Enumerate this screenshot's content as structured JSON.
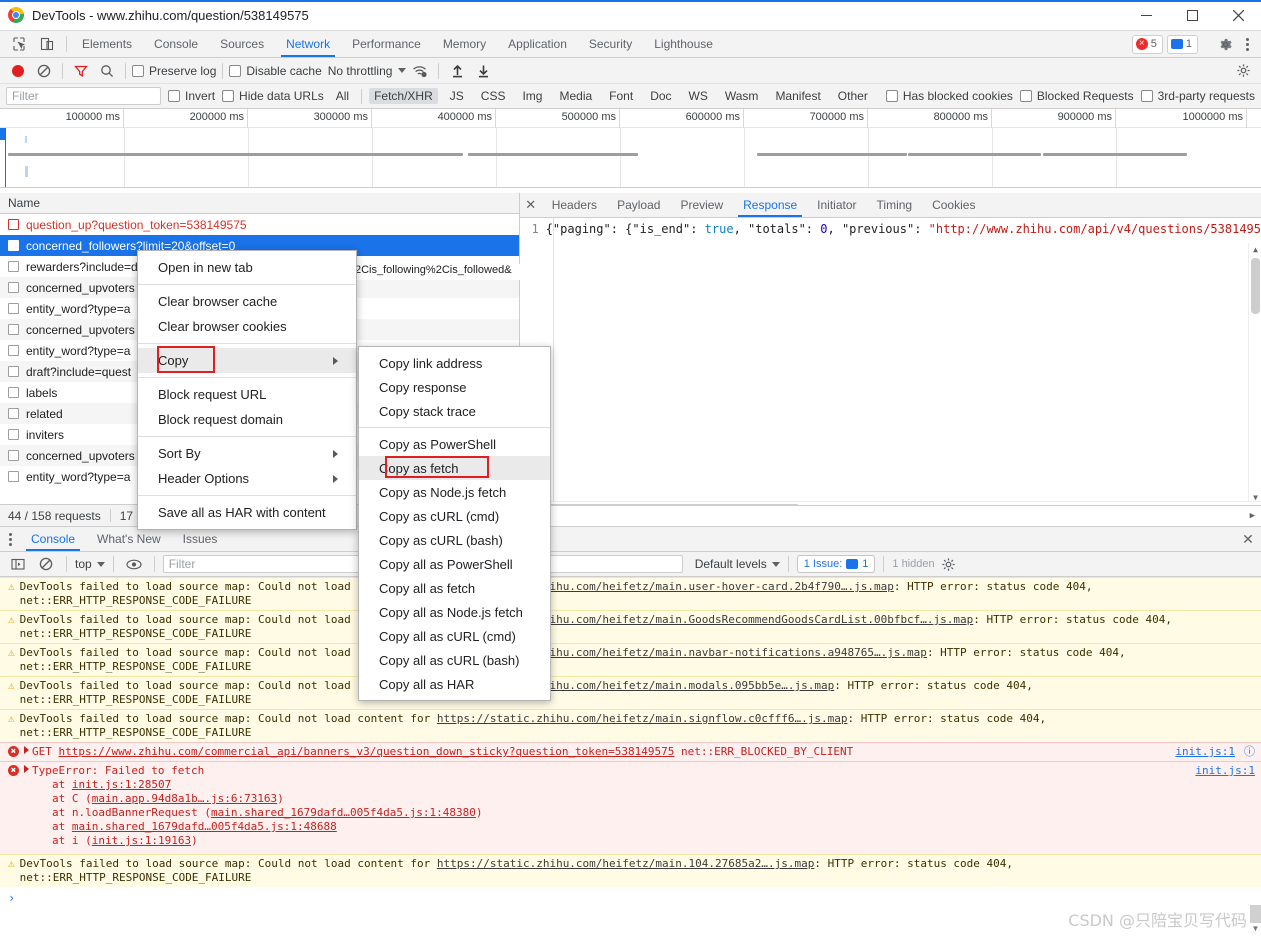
{
  "window": {
    "title": "DevTools - www.zhihu.com/question/538149575",
    "logo_icon": "chrome-logo",
    "minimize": "–",
    "maximize": "□",
    "close": "✕"
  },
  "main_tabs": {
    "inspect_icon": "inspect-cursor-icon",
    "device_icon": "device-toggle-icon",
    "items": [
      {
        "label": "Elements",
        "active": false
      },
      {
        "label": "Console",
        "active": false
      },
      {
        "label": "Sources",
        "active": false
      },
      {
        "label": "Network",
        "active": true
      },
      {
        "label": "Performance",
        "active": false
      },
      {
        "label": "Memory",
        "active": false
      },
      {
        "label": "Application",
        "active": false
      },
      {
        "label": "Security",
        "active": false
      },
      {
        "label": "Lighthouse",
        "active": false
      }
    ],
    "error_badge": "5",
    "message_badge": "1",
    "settings_icon": "gear-icon",
    "more_icon": "kebab-menu-icon"
  },
  "network_toolbar": {
    "record_icon": "record-button",
    "clear_icon": "clear-circle-icon",
    "filter_icon": "funnel-icon",
    "search_icon": "search-icon",
    "preserve_log": "Preserve log",
    "disable_cache": "Disable cache",
    "throttling": "No throttling",
    "wifi_icon": "network-conditions-icon",
    "import_icon": "import-har-icon",
    "export_icon": "export-har-icon",
    "settings_icon": "network-settings-gear-icon"
  },
  "filter_bar": {
    "placeholder": "Filter",
    "invert": "Invert",
    "hide_data_urls": "Hide data URLs",
    "types": [
      {
        "label": "All",
        "active": false
      },
      {
        "label": "Fetch/XHR",
        "active": true
      },
      {
        "label": "JS",
        "active": false
      },
      {
        "label": "CSS",
        "active": false
      },
      {
        "label": "Img",
        "active": false
      },
      {
        "label": "Media",
        "active": false
      },
      {
        "label": "Font",
        "active": false
      },
      {
        "label": "Doc",
        "active": false
      },
      {
        "label": "WS",
        "active": false
      },
      {
        "label": "Wasm",
        "active": false
      },
      {
        "label": "Manifest",
        "active": false
      },
      {
        "label": "Other",
        "active": false
      }
    ],
    "has_blocked_cookies": "Has blocked cookies",
    "blocked_requests": "Blocked Requests",
    "third_party": "3rd-party requests"
  },
  "overview": {
    "ticks": [
      "100000 ms",
      "200000 ms",
      "300000 ms",
      "400000 ms",
      "500000 ms",
      "600000 ms",
      "700000 ms",
      "800000 ms",
      "900000 ms",
      "1000000 ms"
    ]
  },
  "requests": {
    "column_name": "Name",
    "rows": [
      {
        "name": "question_up?question_token=538149575",
        "state": "error"
      },
      {
        "name": "concerned_followers?limit=20&offset=0",
        "state": "selected"
      },
      {
        "name": "rewarders?include=d",
        "state": "normal"
      },
      {
        "name": "concerned_upvoters",
        "state": "normal"
      },
      {
        "name": "entity_word?type=a",
        "state": "normal"
      },
      {
        "name": "concerned_upvoters",
        "state": "normal"
      },
      {
        "name": "entity_word?type=a",
        "state": "normal"
      },
      {
        "name": "draft?include=quest",
        "state": "normal"
      },
      {
        "name": "labels",
        "state": "normal"
      },
      {
        "name": "related",
        "state": "normal"
      },
      {
        "name": "inviters",
        "state": "normal"
      },
      {
        "name": "concerned_upvoters",
        "state": "normal"
      },
      {
        "name": "entity_word?type=a",
        "state": "normal"
      }
    ],
    "status_requests": "44 / 158 requests",
    "status_transferred": "17"
  },
  "detail": {
    "close_icon": "close-icon",
    "tabs": [
      {
        "label": "Headers",
        "active": false
      },
      {
        "label": "Payload",
        "active": false
      },
      {
        "label": "Preview",
        "active": false
      },
      {
        "label": "Response",
        "active": true
      },
      {
        "label": "Initiator",
        "active": false
      },
      {
        "label": "Timing",
        "active": false
      },
      {
        "label": "Cookies",
        "active": false
      }
    ],
    "line_number": "1",
    "response_prefix": "{\"paging\": {\"is_end\": ",
    "response_true": "true",
    "response_mid": ", \"totals\": ",
    "response_zero": "0",
    "response_mid2": ", \"previous\": ",
    "response_url": "\"http://www.zhihu.com/api/v4/questions/5381495",
    "masked_text": "2Cis_following%2Cis_followed&",
    "bottom_brace": "{}"
  },
  "context_menu": {
    "items": [
      {
        "label": "Open in new tab",
        "type": "item"
      },
      {
        "type": "sep"
      },
      {
        "label": "Clear browser cache",
        "type": "item"
      },
      {
        "label": "Clear browser cookies",
        "type": "item"
      },
      {
        "type": "sep"
      },
      {
        "label": "Copy",
        "type": "submenu",
        "highlighted": true
      },
      {
        "type": "sep"
      },
      {
        "label": "Block request URL",
        "type": "item"
      },
      {
        "label": "Block request domain",
        "type": "item"
      },
      {
        "type": "sep"
      },
      {
        "label": "Sort By",
        "type": "submenu"
      },
      {
        "label": "Header Options",
        "type": "submenu"
      },
      {
        "type": "sep"
      },
      {
        "label": "Save all as HAR with content",
        "type": "item"
      }
    ]
  },
  "copy_submenu": {
    "items": [
      {
        "label": "Copy link address",
        "type": "item"
      },
      {
        "label": "Copy response",
        "type": "item"
      },
      {
        "label": "Copy stack trace",
        "type": "item"
      },
      {
        "type": "sep"
      },
      {
        "label": "Copy as PowerShell",
        "type": "item"
      },
      {
        "label": "Copy as fetch",
        "type": "item",
        "highlighted": true
      },
      {
        "label": "Copy as Node.js fetch",
        "type": "item"
      },
      {
        "label": "Copy as cURL (cmd)",
        "type": "item"
      },
      {
        "label": "Copy as cURL (bash)",
        "type": "item"
      },
      {
        "label": "Copy all as PowerShell",
        "type": "item"
      },
      {
        "label": "Copy all as fetch",
        "type": "item"
      },
      {
        "label": "Copy all as Node.js fetch",
        "type": "item"
      },
      {
        "label": "Copy all as cURL (cmd)",
        "type": "item"
      },
      {
        "label": "Copy all as cURL (bash)",
        "type": "item"
      },
      {
        "label": "Copy all as HAR",
        "type": "item"
      }
    ]
  },
  "drawer": {
    "kebab_icon": "kebab-menu-icon",
    "tabs": [
      {
        "label": "Console",
        "active": true
      },
      {
        "label": "What's New",
        "active": false
      },
      {
        "label": "Issues",
        "active": false
      }
    ],
    "close_icon": "close-icon"
  },
  "console_toolbar": {
    "sidebar_icon": "console-sidebar-icon",
    "clear_icon": "clear-console-icon",
    "context": "top",
    "eye_icon": "live-expression-icon",
    "filter_placeholder": "Filter",
    "levels": "Default levels",
    "issue_label": "1 Issue:",
    "issue_count": "1",
    "hidden": "1 hidden",
    "settings_icon": "gear-icon"
  },
  "console_log": {
    "warn_prefix": "DevTools failed to load source map: Could not load content for ",
    "warn_suffix": ": HTTP error: status code 404,",
    "warn_second_line": "net::ERR_HTTP_RESPONSE_CODE_FAILURE",
    "warnings": [
      {
        "url": "https://static.zhihu.com/heifetz/main.user-hover-card.2b4f790….js.map"
      },
      {
        "url": "https://static.zhihu.com/heifetz/main.GoodsRecommendGoodsCardList.00bfbcf….js.map"
      },
      {
        "url": "https://static.zhihu.com/heifetz/main.navbar-notifications.a948765….js.map"
      },
      {
        "url": "https://static.zhihu.com/heifetz/main.modals.095bb5e….js.map"
      },
      {
        "url": "https://static.zhihu.com/heifetz/main.signflow.c0cfff6….js.map"
      }
    ],
    "blocked_error": {
      "method": "GET",
      "url": "https://www.zhihu.com/commercial_api/banners_v3/question_down_sticky?question_token=538149575",
      "status": "net::ERR_BLOCKED_BY_CLIENT",
      "source": "init.js:1"
    },
    "type_error": {
      "title": "TypeError: Failed to fetch",
      "source": "init.js:1",
      "stack": [
        {
          "prefix": "at ",
          "func": "",
          "link": "init.js:1:28507",
          "suffix": ""
        },
        {
          "prefix": "at ",
          "func": "C ",
          "link": "main.app.94d8a1b….js:6:73163",
          "suffix": "",
          "paren": true
        },
        {
          "prefix": "at ",
          "func": "n.loadBannerRequest ",
          "link": "main.shared_1679dafd…005f4da5.js:1:48380",
          "suffix": "",
          "paren": true
        },
        {
          "prefix": "at ",
          "func": "",
          "link": "main.shared_1679dafd…005f4da5.js:1:48688",
          "suffix": ""
        },
        {
          "prefix": "at ",
          "func": "i ",
          "link": "init.js:1:19163",
          "suffix": "",
          "paren": true
        }
      ]
    },
    "final_warning": {
      "url": "https://static.zhihu.com/heifetz/main.104.27685a2….js.map"
    },
    "prompt": "›"
  },
  "watermark": "CSDN @只陪宝贝写代码",
  "colors": {
    "accent": "#1a73e8",
    "error": "#d93025",
    "warn_bg": "#fffbe5",
    "err_bg": "#fff0f0",
    "selection": "#1a73e8",
    "redbox": "#e02020"
  }
}
